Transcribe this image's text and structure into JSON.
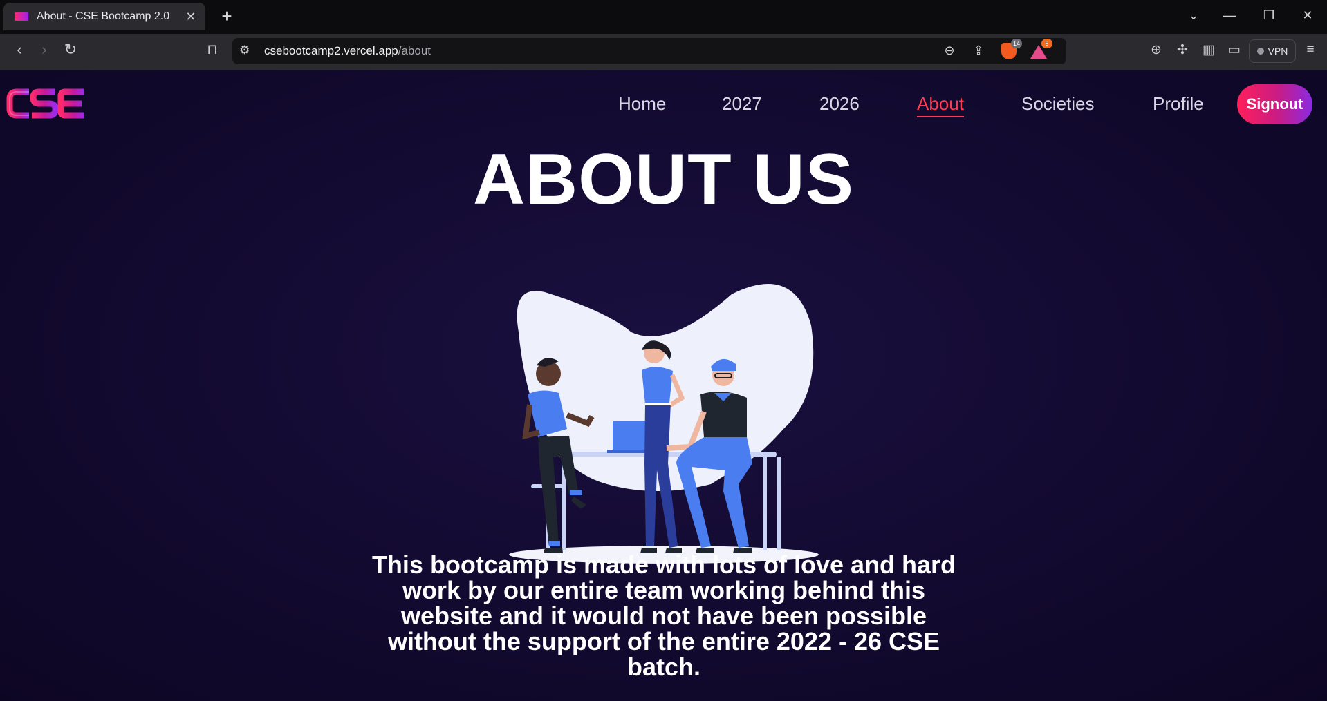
{
  "browser": {
    "tab_title": "About - CSE Bootcamp 2.0",
    "url_host": "csebootcamp2.vercel.app",
    "url_path": "/about",
    "shield_count": "14",
    "rewards_count": "5",
    "vpn_label": "VPN",
    "new_tab_symbol": "+",
    "close_symbol": "✕"
  },
  "site": {
    "logo_text": "CSE",
    "nav": {
      "home": "Home",
      "y2027": "2027",
      "y2026": "2026",
      "about": "About",
      "societies": "Societies",
      "profile": "Profile"
    },
    "signout_label": "Signout",
    "active_nav": "About"
  },
  "main": {
    "heading": "ABOUT US",
    "description": "This bootcamp is made with lots of love and hard work by our entire team working behind this website and it would not have been possible without the support of the entire 2022 - 26 CSE batch."
  },
  "colors": {
    "page_bg": "#140b33",
    "accent": "#ff3b52",
    "signout_gradient_start": "#ff1f5a",
    "signout_gradient_end": "#8a2be2",
    "illustration_blue": "#4a7ef0"
  },
  "icons": {
    "back": "arrow-left-icon",
    "forward": "arrow-right-icon",
    "reload": "reload-icon",
    "bookmark": "bookmark-icon",
    "site_settings": "tune-icon",
    "zoom": "zoom-out-icon",
    "share": "share-icon",
    "brave_shields": "shield-icon",
    "rewards": "triangle-icon",
    "extensions": "puzzle-icon",
    "sidebar": "sidebar-icon",
    "wallet": "wallet-icon",
    "menu": "hamburger-icon"
  }
}
